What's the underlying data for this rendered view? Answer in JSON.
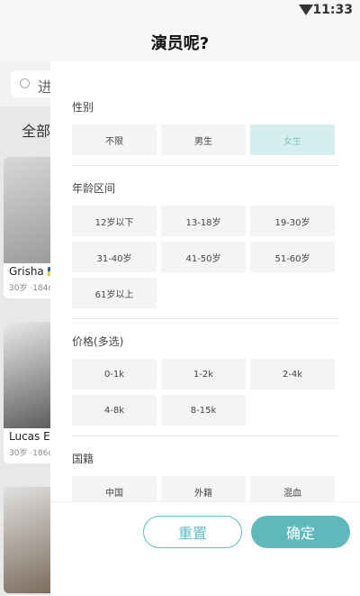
{
  "status": {
    "time": "11:33"
  },
  "header": {
    "title": "演员呢?"
  },
  "search": {
    "text": "进"
  },
  "background": {
    "tab": "全部",
    "cards": [
      {
        "name": "Grisha 🇺🇦",
        "meta": "30岁 ·184cm"
      },
      {
        "name": "Lucas E",
        "meta": "30岁 ·186cm"
      },
      {
        "name": "",
        "meta": ""
      }
    ]
  },
  "filter": {
    "gender": {
      "label": "性别",
      "options": [
        "不限",
        "男生",
        "女生"
      ],
      "selected": "女生"
    },
    "age": {
      "label": "年龄区间",
      "options": [
        "12岁以下",
        "13-18岁",
        "19-30岁",
        "31-40岁",
        "41-50岁",
        "51-60岁",
        "61岁以上"
      ]
    },
    "price": {
      "label": "价格(多选)",
      "options": [
        "0-1k",
        "1-2k",
        "2-4k",
        "4-8k",
        "8-15k"
      ]
    },
    "nationality": {
      "label": "国籍",
      "options": [
        "中国",
        "外籍",
        "混血"
      ]
    }
  },
  "buttons": {
    "reset": "重置",
    "confirm": "确定"
  },
  "colors": {
    "accent": "#5fb8b9",
    "selected_bg": "#d7eeef"
  }
}
